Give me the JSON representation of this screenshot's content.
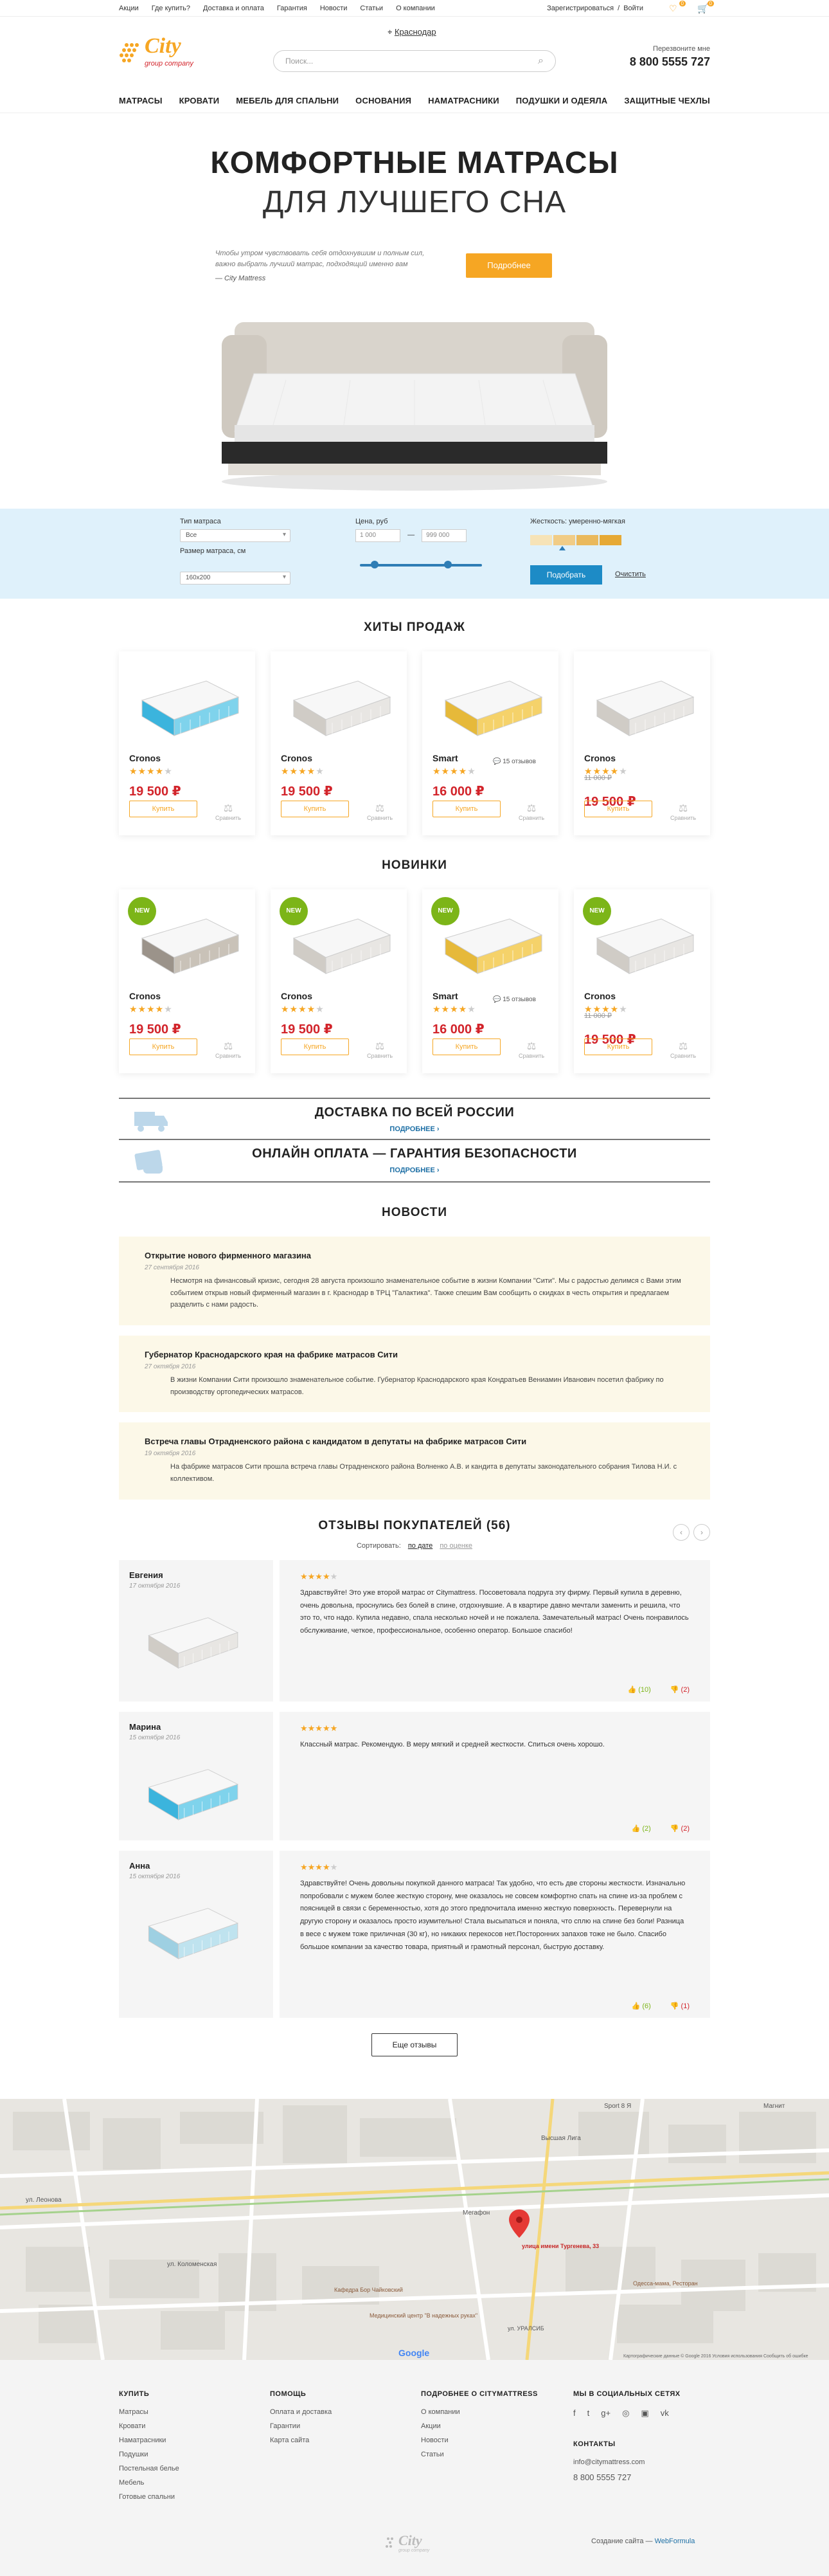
{
  "topbar": {
    "links": [
      "Акции",
      "Где купить?",
      "Доставка и оплата",
      "Гарантия",
      "Новости",
      "Статьи",
      "О компании"
    ],
    "register": "Зарегистрироваться",
    "sep": "/",
    "login": "Войти",
    "wishlist_count": "0",
    "cart_count": "0"
  },
  "header": {
    "logo_text": "City",
    "logo_sub": "group company",
    "city": "Краснодар",
    "search_placeholder": "Поиск...",
    "callback": "Перезвоните мне",
    "phone": "8 800 5555 727"
  },
  "nav": [
    "МАТРАСЫ",
    "КРОВАТИ",
    "МЕБЕЛЬ ДЛЯ СПАЛЬНИ",
    "ОСНОВАНИЯ",
    "НАМАТРАСНИКИ",
    "ПОДУШКИ И ОДЕЯЛА",
    "ЗАЩИТНЫЕ ЧЕХЛЫ"
  ],
  "hero": {
    "title": "КОМФОРТНЫЕ МАТРАСЫ",
    "subtitle": "ДЛЯ ЛУЧШЕГО СНА",
    "quote": "Чтобы утром чувствовать себя отдохнувшим и полным сил, важно выбрать лучший матрас, подходящий именно вам",
    "author": "— City Mattress",
    "button": "Подробнее"
  },
  "filter": {
    "type_label": "Тип матраса",
    "type_value": "Все",
    "size_label": "Размер матраса, см",
    "size_value": "160х200",
    "price_label": "Цена, руб",
    "price_from": "1 000",
    "price_dash": "—",
    "price_to": "999 000",
    "range_low": 0.12,
    "range_high": 0.72,
    "stiff_label": "Жесткость: умеренно-мягкая",
    "stiff_level": 0.35,
    "apply": "Подобрать",
    "clear": "Очистить",
    "stiff_colors": [
      "#f6e3b7",
      "#f1cc86",
      "#eab95c",
      "#e6a935"
    ]
  },
  "hits": {
    "title": "ХИТЫ ПРОДАЖ",
    "items": [
      {
        "name": "Cronos",
        "rating": 4,
        "old": "",
        "price": "19 500 ₽",
        "reviews": "",
        "buy": "Купить",
        "compare": "Сравнить",
        "img": "blue"
      },
      {
        "name": "Cronos",
        "rating": 4,
        "old": "",
        "price": "19 500 ₽",
        "reviews": "",
        "buy": "Купить",
        "compare": "Сравнить",
        "img": "grey"
      },
      {
        "name": "Smart",
        "rating": 4,
        "old": "",
        "price": "16 000 ₽",
        "reviews": "15 отзывов",
        "buy": "Купить",
        "compare": "Сравнить",
        "img": "yellow"
      },
      {
        "name": "Cronos",
        "rating": 4,
        "old": "11 000 ₽",
        "price": "19 500 ₽",
        "reviews": "",
        "buy": "Купить",
        "compare": "Сравнить",
        "img": "grey"
      }
    ]
  },
  "new_items": {
    "title": "НОВИНКИ",
    "badge": "NEW",
    "items": [
      {
        "name": "Cronos",
        "rating": 4,
        "old": "",
        "price": "19 500 ₽",
        "reviews": "",
        "buy": "Купить",
        "compare": "Сравнить",
        "img": "dark"
      },
      {
        "name": "Cronos",
        "rating": 4,
        "old": "",
        "price": "19 500 ₽",
        "reviews": "",
        "buy": "Купить",
        "compare": "Сравнить",
        "img": "grey"
      },
      {
        "name": "Smart",
        "rating": 4,
        "old": "",
        "price": "16 000 ₽",
        "reviews": "15 отзывов",
        "buy": "Купить",
        "compare": "Сравнить",
        "img": "yellow"
      },
      {
        "name": "Cronos",
        "rating": 4,
        "old": "11 000 ₽",
        "price": "19 500 ₽",
        "reviews": "",
        "buy": "Купить",
        "compare": "Сравнить",
        "img": "grey"
      }
    ]
  },
  "info": [
    {
      "title": "ДОСТАВКА ПО ВСЕЙ РОССИИ",
      "more": "ПОДРОБНЕЕ",
      "icon": "truck-icon"
    },
    {
      "title": "ОНЛАЙН ОПЛАТА — ГАРАНТИЯ БЕЗОПАСНОСТИ",
      "more": "ПОДРОБНЕЕ",
      "icon": "card-icon"
    }
  ],
  "news": {
    "title": "НОВОСТИ",
    "items": [
      {
        "title": "Открытие нового фирменного магазина",
        "date": "27 сентября 2016",
        "text": "Несмотря на финансовый кризис, сегодня 28 августа произошло знаменательное событие в жизни Компании \"Сити\". Мы с радостью делимся с Вами этим событием открыв новый фирменный магазин в г. Краснодар в ТРЦ \"Галактика\". Также спешим Вам сообщить о скидках в честь открытия и предлагаем разделить с нами радость."
      },
      {
        "title": "Губернатор Краснодарского края на фабрике матрасов Сити",
        "date": "27 октября 2016",
        "text": "В жизни Компании Сити произошло знаменательное событие. Губернатор Краснодарского края Кондратьев Вениамин Иванович посетил фабрику по производству ортопедических матрасов."
      },
      {
        "title": "Встреча главы Отрадненского района с кандидатом в депутаты на фабрике матрасов Сити",
        "date": "19 октября 2016",
        "text": "На фабрике матрасов Сити прошла встреча главы Отрадненского района Волненко А.В. и кандита в депутаты законодательного собрания Тилова Н.И. с коллективом."
      }
    ]
  },
  "reviews": {
    "title": "ОТЗЫВЫ ПОКУПАТЕЛЕЙ (56)",
    "sort_label": "Сортировать:",
    "sort_date": "по дате",
    "sort_rating": "по оценке",
    "more": "Еще отзывы",
    "items": [
      {
        "name": "Евгения",
        "date": "17 октября 2016",
        "rating": 4,
        "text": "Здравствуйте! Это уже второй матрас от Citymattress. Посоветовала подруга эту фирму. Первый купила в деревню, очень довольна, проснулись без болей в спине, отдохнувшие. А в квартире давно мечтали заменить и решила, что это то, что надо. Купила недавно, спала несколько ночей и не пожалела. Замечательный матрас! Очень понравилось обслуживание, четкое, профессиональное, особенно оператор. Большое спасибо!",
        "up": "(10)",
        "down": "(2)",
        "img": "grey"
      },
      {
        "name": "Марина",
        "date": "15 октября 2016",
        "rating": 5,
        "text": "Классный матрас. Рекомендую. В меру мягкий и средней жесткости. Спиться очень хорошо.",
        "up": "(2)",
        "down": "(2)",
        "img": "blue"
      },
      {
        "name": "Анна",
        "date": "15 октября 2016",
        "rating": 4,
        "text": "Здравствуйте! Очень довольны покупкой данного матраса! Так удобно, что есть две стороны жесткости. Изначально попробовали с мужем более жесткую сторону, мне оказалось не совсем комфортно спать на спине из-за проблем с поясницей в связи с беременностью, хотя до этого предпочитала именно жесткую поверхность. Перевернули на другую сторону и оказалось просто изумительно! Стала высыпаться и поняла, что сплю на спине без боли! Разница в весе с мужем тоже приличная (30 кг), но никаких перекосов нет.Посторонних запахов тоже не было. Спасибо большое компании за качество товара, приятный и грамотный персонал, быструю доставку.",
        "up": "(6)",
        "down": "(1)",
        "img": "cloud"
      }
    ]
  },
  "map": {
    "street1": "Sport 8 Я",
    "street2": "Высшая Лига",
    "street3": "Магнит",
    "street4": "Мегафон",
    "marker": "улица имени Тургенева, 33",
    "poi1": "Кафедра Бор Чайковский",
    "poi2": "Медицинский центр \"В надежных руках\"",
    "poi3": "Одесса-мама, Ресторан",
    "poi4": "ул. УРАЛСИБ",
    "road1": "ул. Леонова",
    "road2": "ул. Коломенская",
    "google": "Google",
    "attribution": "Картографические данные © Google 2016   Условия использования   Сообщить об ошибке"
  },
  "footer": {
    "cols": [
      {
        "title": "КУПИТЬ",
        "links": [
          "Матрасы",
          "Кровати",
          "Наматрасники",
          "Подушки",
          "Постельная белье",
          "Мебель",
          "Готовые спальни"
        ]
      },
      {
        "title": "ПОМОЩЬ",
        "links": [
          "Оплата и доставка",
          "Гарантии",
          "Карта сайта"
        ]
      },
      {
        "title": "ПОДРОБНЕЕ О CITYMATTRESS",
        "links": [
          "О компании",
          "Акции",
          "Новости",
          "Статьи"
        ]
      }
    ],
    "social_title": "МЫ В СОЦИАЛЬНЫХ СЕТЯХ",
    "social_icons": [
      "f",
      "t",
      "g+",
      "◎",
      "▣",
      "vk"
    ],
    "contacts_title": "КОНТАКТЫ",
    "email": "info@citymattress.com",
    "phone": "8 800 5555 727",
    "copy_text": "Создание сайта —",
    "copy_link": "WebFormula"
  }
}
